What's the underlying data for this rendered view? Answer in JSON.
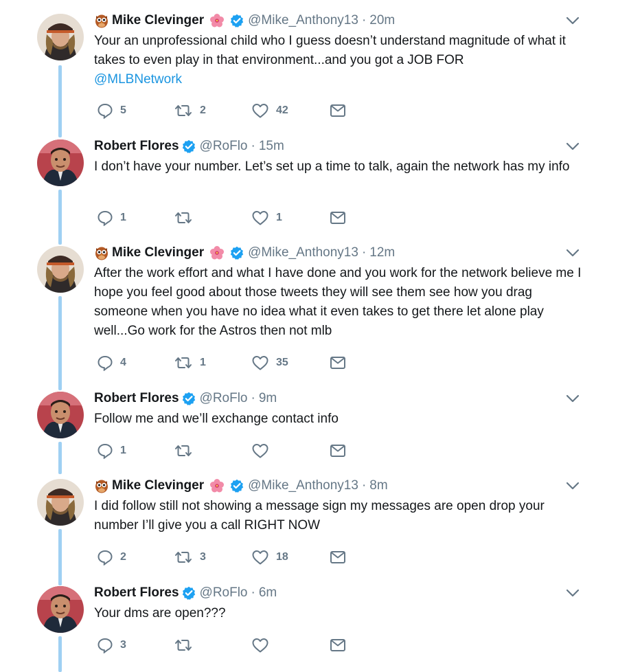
{
  "colors": {
    "link": "#1b95e0",
    "secondary": "#657786",
    "thread_line": "#9fd0f3",
    "verified": "#1da1f2"
  },
  "tweets": [
    {
      "name": "Mike Clevinger",
      "name_emoji_left": "owl-emoji",
      "name_emoji_right": "hibiscus-emoji",
      "handle": "@Mike_Anthony13",
      "time": "20m",
      "text": "Your an unprofessional child who I guess doesn’t understand magnitude of what it takes to even play in that environment...and you got a JOB FOR",
      "mention": "@MLBNetwork",
      "replies": "5",
      "retweets": "2",
      "likes": "42"
    },
    {
      "name": "Robert Flores",
      "handle": "@RoFlo",
      "time": "15m",
      "text": "I don’t have your number. Let’s set up a time to talk, again the network has my info",
      "replies": "1",
      "retweets": "",
      "likes": "1"
    },
    {
      "name": "Mike Clevinger",
      "name_emoji_left": "owl-emoji",
      "name_emoji_right": "hibiscus-emoji",
      "handle": "@Mike_Anthony13",
      "time": "12m",
      "text": "After the work effort and what I have done and you work for the network believe me I hope you feel good about those tweets they will see them see how you drag someone when you have no idea what it even takes to get there let alone play well...Go work for the Astros then not mlb",
      "replies": "4",
      "retweets": "1",
      "likes": "35"
    },
    {
      "name": "Robert Flores",
      "handle": "@RoFlo",
      "time": "9m",
      "text": "Follow me and we’ll exchange contact info",
      "replies": "1",
      "retweets": "",
      "likes": ""
    },
    {
      "name": "Mike Clevinger",
      "name_emoji_left": "owl-emoji",
      "name_emoji_right": "hibiscus-emoji",
      "handle": "@Mike_Anthony13",
      "time": "8m",
      "text": "I did follow still not showing a message sign my messages are open drop your number I’ll give you a call RIGHT NOW",
      "replies": "2",
      "retweets": "3",
      "likes": "18"
    },
    {
      "name": "Robert Flores",
      "handle": "@RoFlo",
      "time": "6m",
      "text": "Your dms are open???",
      "replies": "3",
      "retweets": "",
      "likes": ""
    }
  ],
  "separator": "·"
}
